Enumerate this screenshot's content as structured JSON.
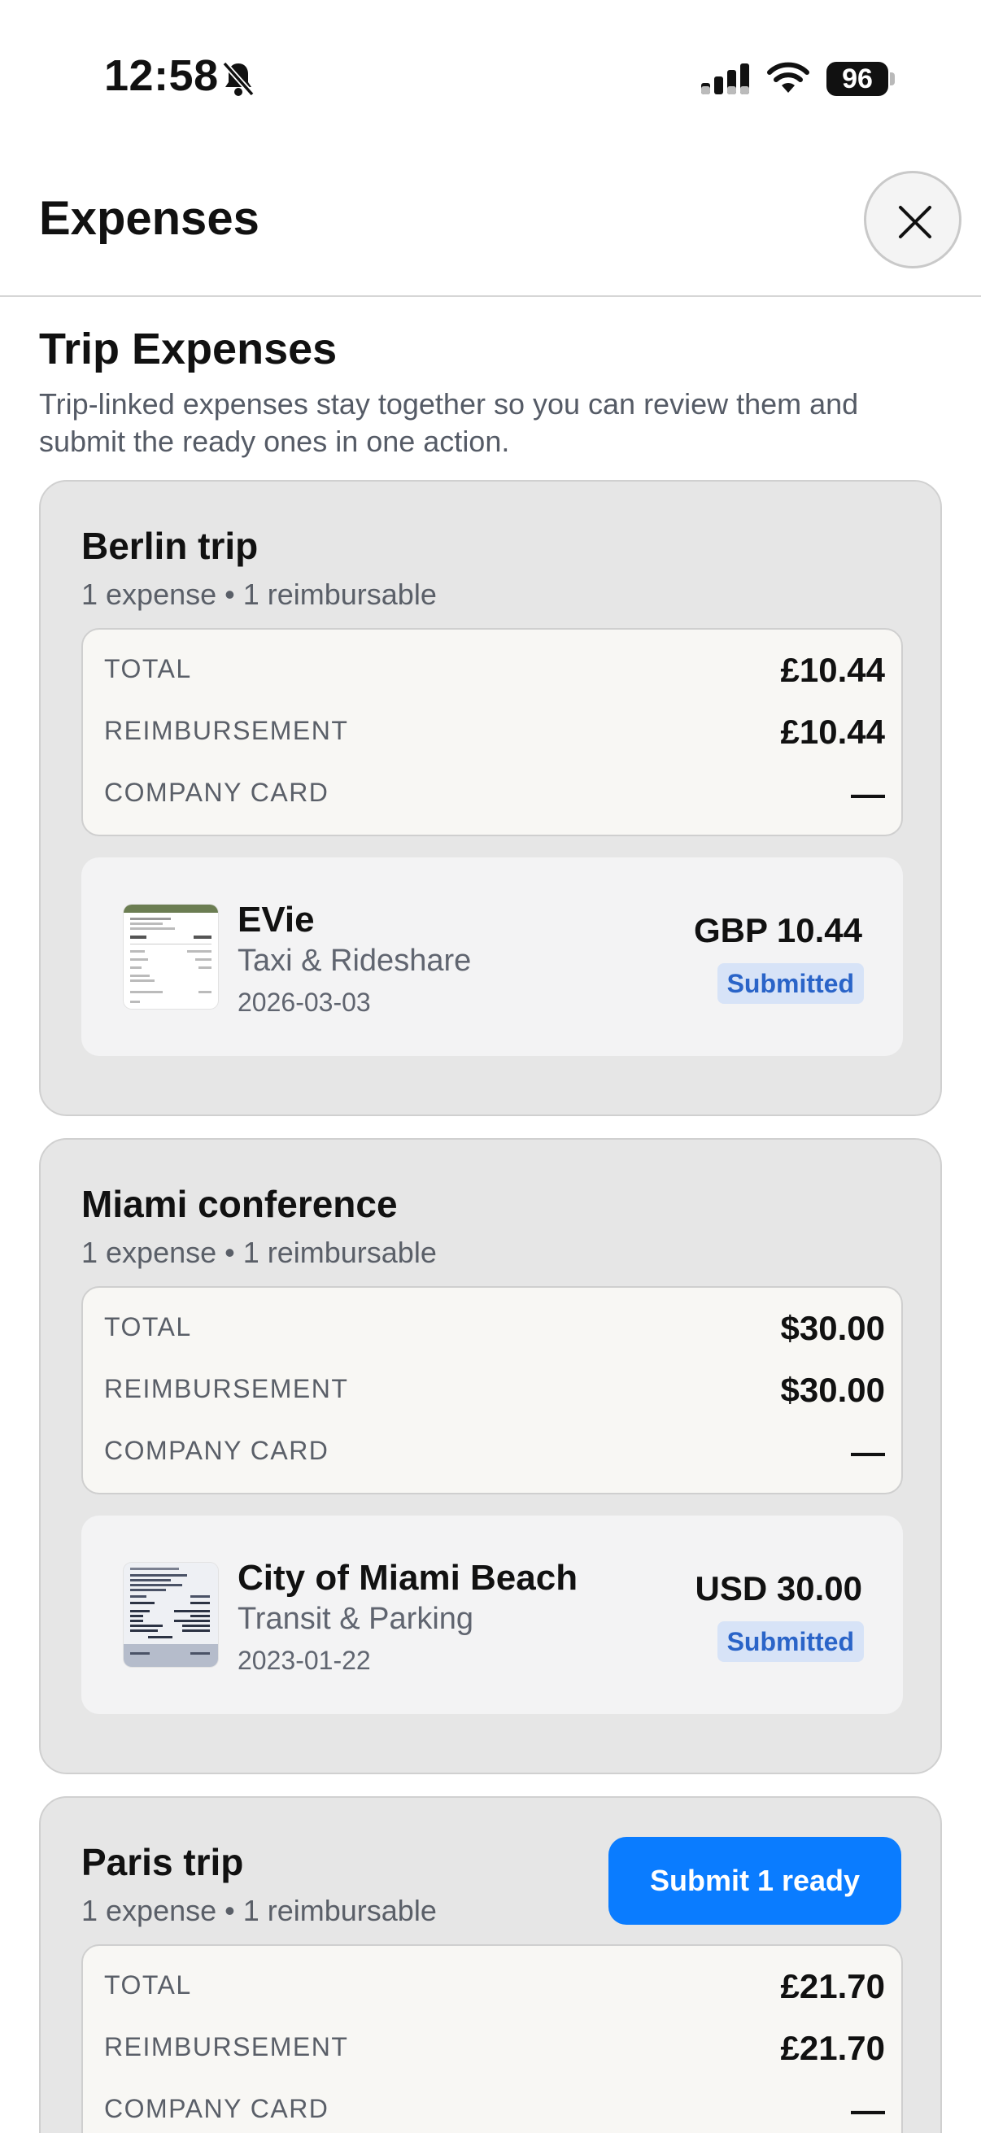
{
  "status_bar": {
    "time": "12:58",
    "battery": "96"
  },
  "header": {
    "title": "Expenses"
  },
  "section": {
    "title": "Trip Expenses",
    "description": "Trip-linked expenses stay together so you can review them and submit the ready ones in one action."
  },
  "labels": {
    "total": "TOTAL",
    "reimbursement": "REIMBURSEMENT",
    "company_card": "COMPANY CARD"
  },
  "trips": [
    {
      "name": "Berlin trip",
      "meta": "1 expense • 1 reimbursable",
      "total": "£10.44",
      "reimbursement": "£10.44",
      "company_card": "—",
      "expense": {
        "merchant": "EVie",
        "category": "Taxi & Rideshare",
        "date": "2026-03-03",
        "amount": "GBP 10.44",
        "status": "Submitted"
      }
    },
    {
      "name": "Miami conference",
      "meta": "1 expense • 1 reimbursable",
      "total": "$30.00",
      "reimbursement": "$30.00",
      "company_card": "—",
      "expense": {
        "merchant": "City of Miami Beach",
        "category": "Transit & Parking",
        "date": "2023-01-22",
        "amount": "USD 30.00",
        "status": "Submitted"
      }
    },
    {
      "name": "Paris trip",
      "meta": "1 expense • 1 reimbursable",
      "submit_label": "Submit 1 ready",
      "total": "£21.70",
      "reimbursement": "£21.70",
      "company_card": "—"
    }
  ],
  "colors": {
    "accent": "#0a7cff",
    "badge_bg": "#d7e3f7",
    "badge_text": "#2a64c8",
    "card_bg": "#e6e6e6"
  }
}
